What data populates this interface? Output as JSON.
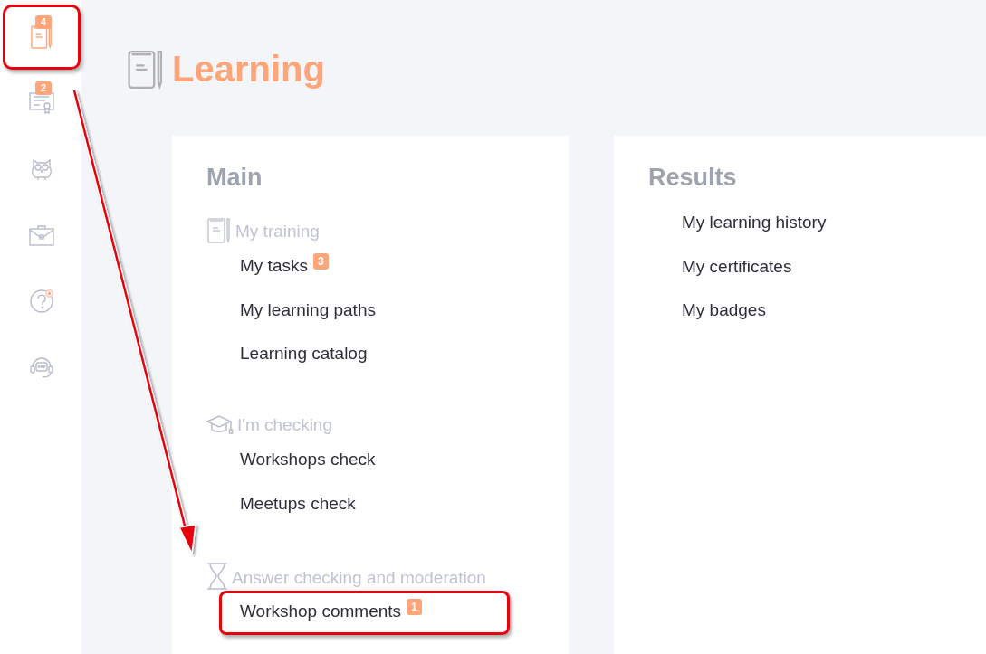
{
  "sidebar": {
    "items": [
      {
        "badge": "4",
        "selected": true,
        "annotated": true,
        "dot": false
      },
      {
        "badge": "2",
        "selected": false,
        "annotated": false,
        "dot": false
      },
      {
        "selected": false,
        "annotated": false,
        "dot": false
      },
      {
        "selected": false,
        "annotated": false,
        "dot": false
      },
      {
        "selected": false,
        "annotated": false,
        "dot": true
      },
      {
        "selected": false,
        "annotated": false,
        "dot": false
      }
    ]
  },
  "page_title": "Learning",
  "panels": [
    {
      "title": "Main",
      "groups": [
        {
          "label": "My training",
          "links": [
            {
              "text": "My tasks",
              "badge": "3",
              "annotated": false
            },
            {
              "text": "My learning paths",
              "annotated": false
            },
            {
              "text": "Learning catalog",
              "annotated": false
            }
          ]
        },
        {
          "label": "I'm checking",
          "links": [
            {
              "text": "Workshops check",
              "annotated": false
            },
            {
              "text": "Meetups check",
              "annotated": false
            }
          ]
        },
        {
          "label": "Answer checking and moderation",
          "links": [
            {
              "text": "Workshop comments",
              "badge": "1",
              "annotated": true
            }
          ]
        }
      ]
    },
    {
      "title": "Results",
      "groups": [
        {
          "links": [
            {
              "text": "My learning history",
              "annotated": false
            },
            {
              "text": "My certificates",
              "annotated": false
            },
            {
              "text": "My badges",
              "annotated": false
            }
          ]
        }
      ]
    }
  ]
}
